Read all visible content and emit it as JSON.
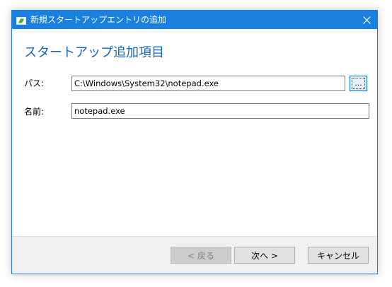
{
  "window": {
    "title": "新規スタートアップエントリの追加",
    "close_icon": "close-icon",
    "app_icon": "startup-app-icon",
    "accent_color": "#1a80e0"
  },
  "form": {
    "heading": "スタートアップ追加項目",
    "path_label": "パス:",
    "path_value": "C:\\Windows\\System32\\notepad.exe",
    "browse_label": "...",
    "name_label": "名前:",
    "name_value": "notepad.exe"
  },
  "footer": {
    "back_label": "< 戻る",
    "next_label": "次へ >",
    "cancel_label": "キャンセル"
  }
}
